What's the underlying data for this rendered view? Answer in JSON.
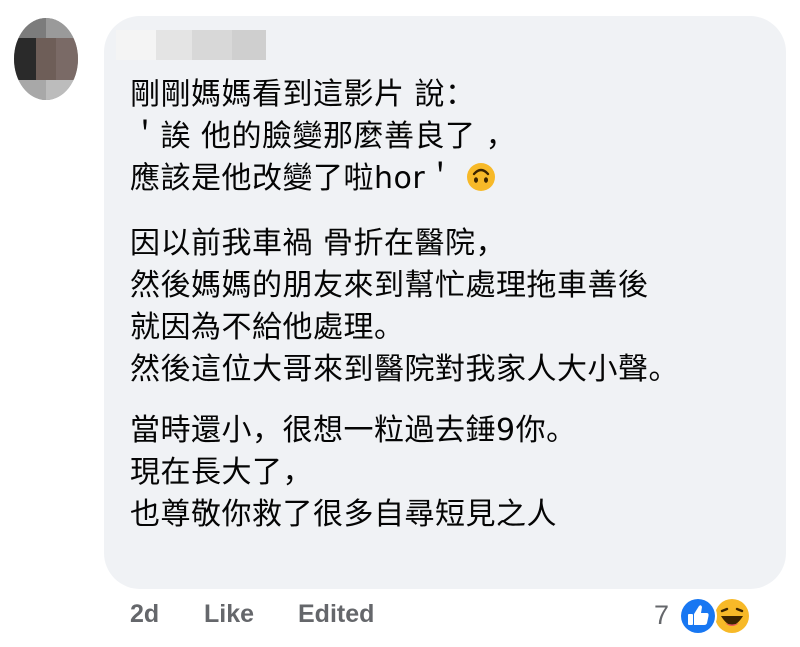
{
  "comment": {
    "paragraphs": [
      {
        "lines": [
          "剛剛媽媽看到這影片 說：",
          "＇誒 他的臉變那麼善良了 ，",
          "應該是他改變了啦hor＇"
        ],
        "trailing_icon": "upside-down-face-icon"
      },
      {
        "lines": [
          "因以前我車禍 骨折在醫院，",
          "然後媽媽的朋友來到幫忙處理拖車善後",
          "就因為不給他處理。",
          "然後這位大哥來到醫院對我家人大小聲。"
        ]
      },
      {
        "lines": [
          "當時還小，很想一粒過去錘9你。",
          "現在長大了，",
          "也尊敬你救了很多自尋短見之人"
        ]
      }
    ]
  },
  "actions": {
    "time": "2d",
    "like_label": "Like",
    "edited_label": "Edited"
  },
  "reactions": {
    "count": "7",
    "icons": [
      "like-reaction-icon",
      "haha-reaction-icon"
    ],
    "like_color": "#1877f2",
    "haha_color": "#f7b928"
  },
  "colors": {
    "bubble": "#f0f2f5",
    "text": "#050505",
    "meta": "#65676b"
  }
}
